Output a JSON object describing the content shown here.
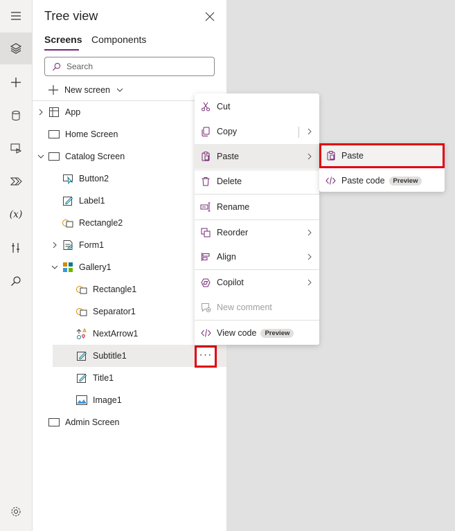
{
  "rail": {
    "items": [
      {
        "icon": "hamburger-icon"
      },
      {
        "icon": "layers-icon",
        "active": true
      },
      {
        "icon": "plus-icon"
      },
      {
        "icon": "database-icon"
      },
      {
        "icon": "media-icon"
      },
      {
        "icon": "power-automate-icon"
      },
      {
        "icon": "variables-icon",
        "label": "(x)"
      },
      {
        "icon": "tools-icon"
      },
      {
        "icon": "search-icon"
      },
      {
        "icon": "settings-icon"
      }
    ]
  },
  "panel": {
    "title": "Tree view",
    "tabs": [
      {
        "label": "Screens",
        "selected": true
      },
      {
        "label": "Components",
        "selected": false
      }
    ],
    "search_placeholder": "Search",
    "new_screen_label": "New screen"
  },
  "tree": [
    {
      "label": "App",
      "icon": "app-icon",
      "expandable": true,
      "expanded": false,
      "level": 0
    },
    {
      "label": "Home Screen",
      "icon": "screen-icon",
      "expandable": false,
      "level": 0
    },
    {
      "label": "Catalog Screen",
      "icon": "screen-icon",
      "expandable": true,
      "expanded": true,
      "level": 0
    },
    {
      "label": "Button2",
      "icon": "button-icon",
      "expandable": false,
      "level": 1
    },
    {
      "label": "Label1",
      "icon": "label-icon",
      "expandable": false,
      "level": 1
    },
    {
      "label": "Rectangle2",
      "icon": "shape-icon",
      "expandable": false,
      "level": 1
    },
    {
      "label": "Form1",
      "icon": "form-icon",
      "expandable": true,
      "expanded": false,
      "level": 1
    },
    {
      "label": "Gallery1",
      "icon": "gallery-icon",
      "expandable": true,
      "expanded": true,
      "level": 1
    },
    {
      "label": "Rectangle1",
      "icon": "shape-icon",
      "expandable": false,
      "level": 2
    },
    {
      "label": "Separator1",
      "icon": "shape-icon",
      "expandable": false,
      "level": 2
    },
    {
      "label": "NextArrow1",
      "icon": "icon-control-icon",
      "expandable": false,
      "level": 2
    },
    {
      "label": "Subtitle1",
      "icon": "label-icon",
      "expandable": false,
      "level": 2,
      "selected": true
    },
    {
      "label": "Title1",
      "icon": "label-icon",
      "expandable": false,
      "level": 2
    },
    {
      "label": "Image1",
      "icon": "image-icon",
      "expandable": false,
      "level": 2
    },
    {
      "label": "Admin Screen",
      "icon": "screen-icon",
      "expandable": false,
      "level": 0
    }
  ],
  "more_button": {
    "label": "···"
  },
  "context_menu": {
    "items": [
      {
        "label": "Cut",
        "icon": "cut-icon"
      },
      {
        "label": "Copy",
        "icon": "copy-icon",
        "submenu": true
      },
      {
        "label": "Paste",
        "icon": "paste-icon",
        "submenu": true,
        "hover": true
      },
      {
        "label": "Delete",
        "icon": "delete-icon"
      },
      {
        "label": "Rename",
        "icon": "rename-icon"
      },
      {
        "label": "Reorder",
        "icon": "reorder-icon",
        "submenu": true
      },
      {
        "label": "Align",
        "icon": "align-icon",
        "submenu": true
      },
      {
        "label": "Copilot",
        "icon": "copilot-icon",
        "submenu": true
      },
      {
        "label": "New comment",
        "icon": "comment-icon",
        "disabled": true
      },
      {
        "label": "View code",
        "icon": "code-icon",
        "badge": "Preview"
      }
    ]
  },
  "paste_submenu": {
    "items": [
      {
        "label": "Paste",
        "icon": "paste-icon"
      },
      {
        "label": "Paste code",
        "icon": "code-icon",
        "badge": "Preview"
      }
    ]
  },
  "colors": {
    "accent": "#742774",
    "highlight_border": "#e0000f",
    "canvas": "#e1e1e1"
  }
}
